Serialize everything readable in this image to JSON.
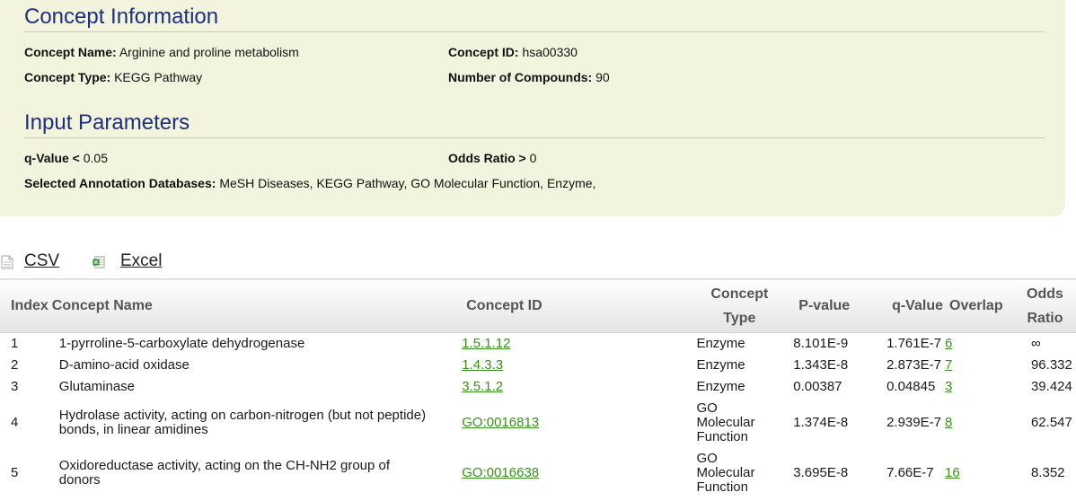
{
  "concept_info": {
    "heading": "Concept Information",
    "name_label": "Concept Name:",
    "name_value": "Arginine and proline metabolism",
    "id_label": "Concept ID:",
    "id_value": "hsa00330",
    "type_label": "Concept Type:",
    "type_value": "KEGG Pathway",
    "compounds_label": "Number of Compounds:",
    "compounds_value": "90"
  },
  "input_params": {
    "heading": "Input Parameters",
    "qvalue_label": "q-Value <",
    "qvalue_value": "0.05",
    "odds_label": "Odds Ratio >",
    "odds_value": "0",
    "dbs_label": "Selected Annotation Databases:",
    "dbs_value": "MeSH Diseases, KEGG Pathway, GO Molecular Function, Enzyme,"
  },
  "export": {
    "csv_label": "CSV",
    "excel_label": "Excel",
    "csv_icon": "document-icon",
    "excel_icon": "excel-icon"
  },
  "table": {
    "headers": {
      "index": "Index",
      "name": "Concept Name",
      "id": "Concept ID",
      "type_line1": "Concept",
      "type_line2": "Type",
      "pvalue": "P-value",
      "qvalue": "q-Value",
      "overlap": "Overlap",
      "odds_line1": "Odds",
      "odds_line2": "Ratio"
    },
    "rows": [
      {
        "index": "1",
        "name": "1-pyrroline-5-carboxylate dehydrogenase",
        "id": "1.5.1.12",
        "type": "Enzyme",
        "pvalue": "8.101E-9",
        "qvalue": "1.761E-7",
        "overlap": "6",
        "odds": "∞"
      },
      {
        "index": "2",
        "name": "D-amino-acid oxidase",
        "id": "1.4.3.3",
        "type": "Enzyme",
        "pvalue": "1.343E-8",
        "qvalue": "2.873E-7",
        "overlap": "7",
        "odds": "96.332"
      },
      {
        "index": "3",
        "name": "Glutaminase",
        "id": "3.5.1.2",
        "type": "Enzyme",
        "pvalue": "0.00387",
        "qvalue": "0.04845",
        "overlap": "3",
        "odds": "39.424"
      },
      {
        "index": "4",
        "name_line1": "Hydrolase activity, acting on carbon-nitrogen (but not peptide)",
        "name_line2": "bonds, in linear amidines",
        "id": "GO:0016813",
        "type_line1": "GO",
        "type_line2": "Molecular",
        "type_line3": "Function",
        "pvalue": "1.374E-8",
        "qvalue": "2.939E-7",
        "overlap": "8",
        "odds": "62.547"
      },
      {
        "index": "5",
        "name_line1": "Oxidoreductase activity, acting on the CH-NH2 group of",
        "name_line2": "donors",
        "id": "GO:0016638",
        "type_line1": "GO",
        "type_line2": "Molecular",
        "type_line3": "Function",
        "pvalue": "3.695E-8",
        "qvalue": "7.66E-7",
        "overlap": "16",
        "odds": "8.352"
      }
    ]
  },
  "colors": {
    "panel_bg": "#f2f4de",
    "heading": "#1f2f7a",
    "link_green": "#3d8c1f"
  }
}
